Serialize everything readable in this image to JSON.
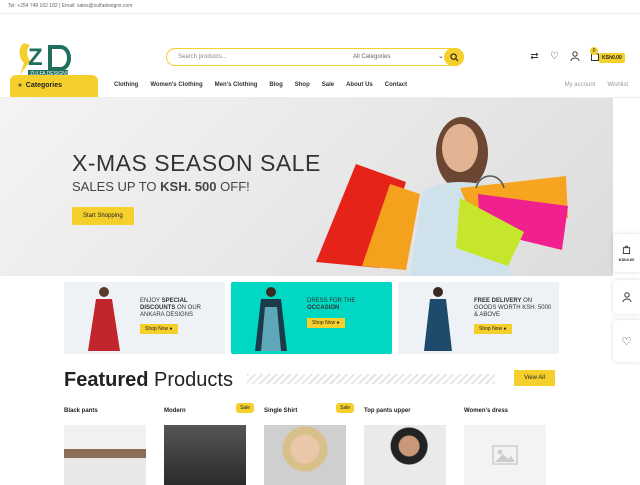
{
  "topbar": {
    "contact": "Tel: +254 748 162 182 | Email: sales@zulfadesigns.com"
  },
  "brand": {
    "logo_text": "ZULFA DESIGNS"
  },
  "search": {
    "placeholder": "Search products...",
    "category": "All Categories"
  },
  "header": {
    "cart_count": "0",
    "cart_amount": "KSh0.00"
  },
  "nav": {
    "categories_label": "Categories",
    "links": [
      "Clothing",
      "Women's Clothing",
      "Men's Clothing",
      "Blog",
      "Shop",
      "Sale",
      "About Us",
      "Contact"
    ],
    "right": [
      "My account",
      "Wishlist"
    ]
  },
  "hero": {
    "title": "X-MAS SEASON SALE",
    "subtitle_prefix": "SALES UP TO ",
    "subtitle_bold": "KSH. 500",
    "subtitle_suffix": " OFF!",
    "button": "Start Shopping"
  },
  "side": {
    "cart_amount": "KSh0.00"
  },
  "promos": [
    {
      "line1": "ENJOY ",
      "bold": "SPECIAL DISCOUNTS",
      "line2": " ON OUR ANKARA DESIGNS",
      "button": "Shop Now"
    },
    {
      "line1": "DRESS FOR THE ",
      "bold": "OCCASION",
      "line2": "",
      "button": "Shop Now"
    },
    {
      "line1": "",
      "bold": "FREE DELIVERY",
      "line2": " ON GOODS WORTH KSH. 5000 & ABOVE",
      "button": "Shop Now"
    }
  ],
  "featured": {
    "title_bold": "Featured",
    "title_rest": " Products",
    "view_all": "View All"
  },
  "products": [
    {
      "name": "Black pants",
      "sale": ""
    },
    {
      "name": "Modern",
      "sale": "Sale"
    },
    {
      "name": "Single Shirt",
      "sale": "Sale"
    },
    {
      "name": "Top pants upper",
      "sale": ""
    },
    {
      "name": "Women's dress",
      "sale": ""
    }
  ],
  "colors": {
    "accent": "#f5d02c",
    "teal": "#00d8c3",
    "brand_green": "#1f6f5c"
  }
}
